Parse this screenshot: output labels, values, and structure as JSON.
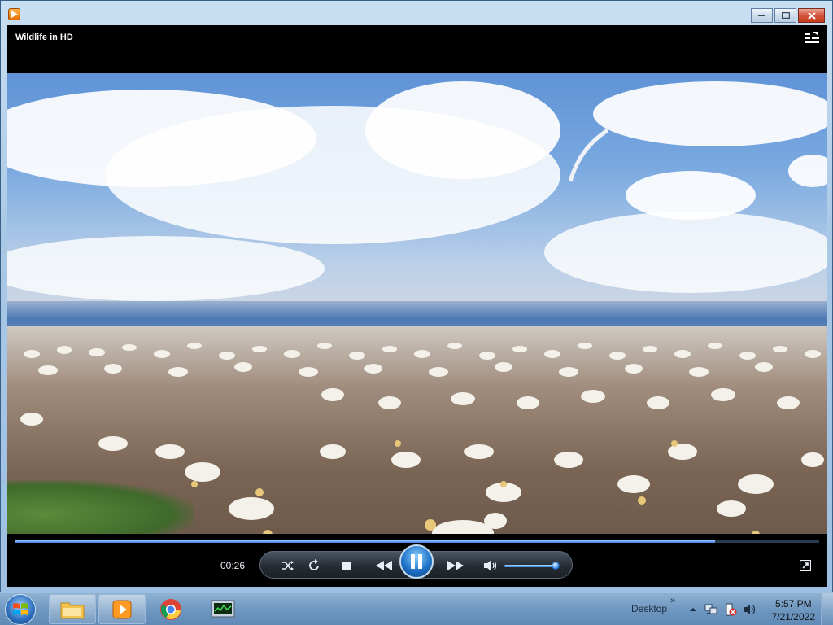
{
  "window": {
    "app_icon": "media-player-icon",
    "controls": [
      "minimize-icon",
      "maximize-icon",
      "close-icon"
    ]
  },
  "player": {
    "title": "Wildlife in HD",
    "elapsed": "00:26",
    "seek_progress": 0.87,
    "volume_level": 0.92
  },
  "taskbar": {
    "toolbar_label": "Desktop",
    "time": "5:57 PM",
    "date": "7/21/2022"
  }
}
